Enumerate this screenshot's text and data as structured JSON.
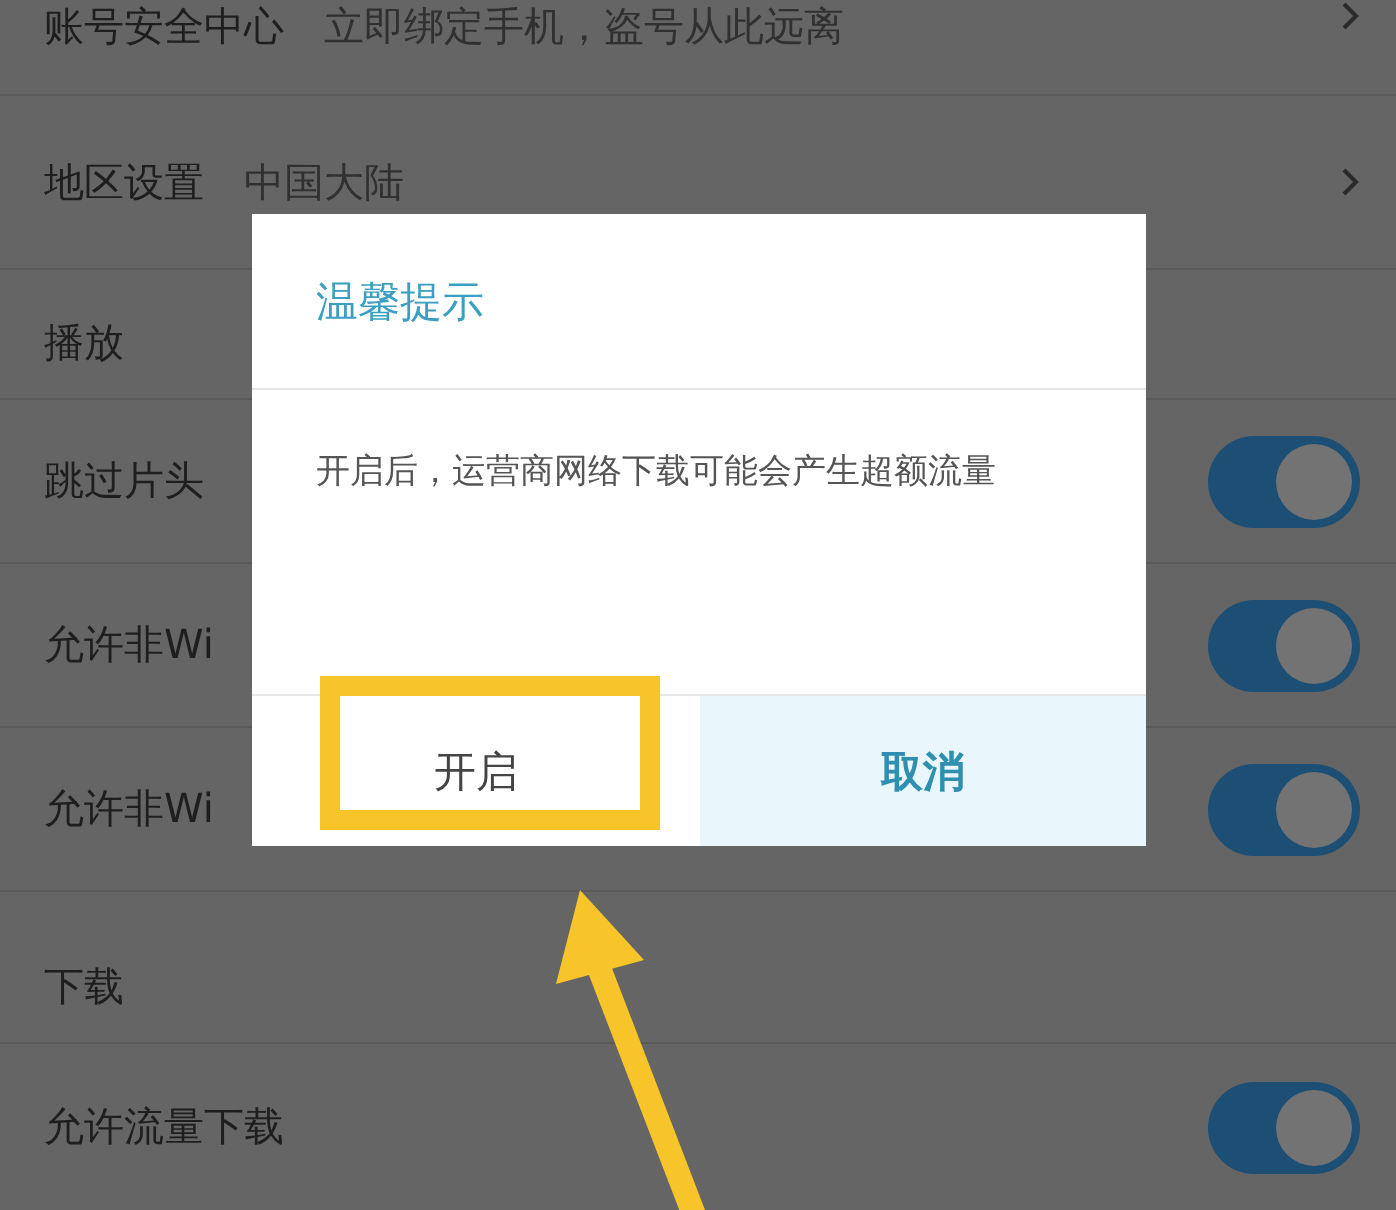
{
  "settings": {
    "items": [
      {
        "kind": "link",
        "label": "账号安全中心",
        "value": "立即绑定手机，盗号从此远离"
      },
      {
        "kind": "link",
        "label": "地区设置",
        "value": "中国大陆"
      },
      {
        "kind": "section",
        "label": "播放"
      },
      {
        "kind": "toggle",
        "label": "跳过片头",
        "on": true
      },
      {
        "kind": "toggle",
        "label": "允许非Wi",
        "on": true
      },
      {
        "kind": "toggle",
        "label": "允许非Wi",
        "on": true
      },
      {
        "kind": "section",
        "label": "下载"
      },
      {
        "kind": "toggle",
        "label": "允许流量下载",
        "on": true
      }
    ]
  },
  "dialog": {
    "title": "温馨提示",
    "message": "开启后，运营商网络下载可能会产生超额流量",
    "buttons": [
      {
        "label": "开启",
        "kind": "confirm",
        "annotated": true
      },
      {
        "label": "取消",
        "kind": "cancel",
        "annotated": false
      }
    ]
  }
}
